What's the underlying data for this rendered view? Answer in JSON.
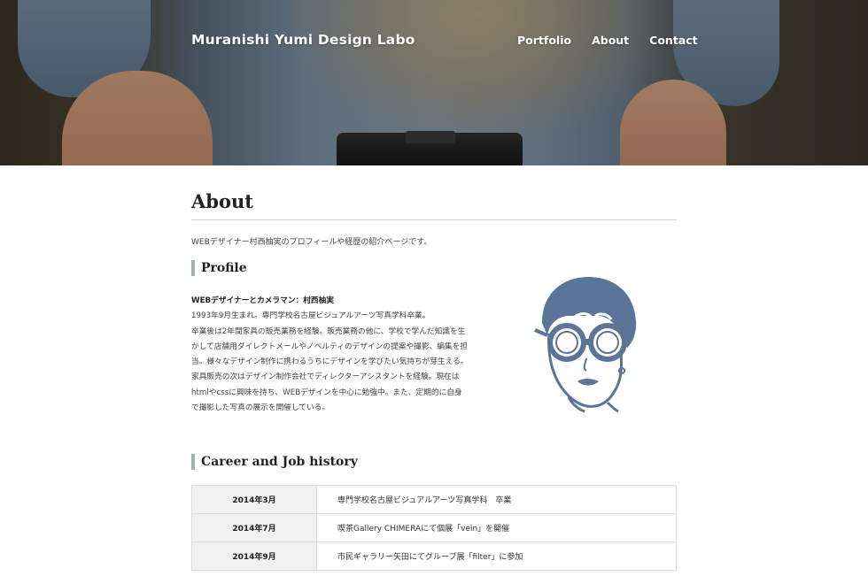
{
  "header": {
    "brand": "Muranishi Yumi Design Labo",
    "nav": [
      "Portfolio",
      "About",
      "Contact"
    ]
  },
  "page": {
    "title": "About",
    "intro": "WEBデザイナー村西柚実のプロフィールや経歴の紹介ページです。"
  },
  "profile": {
    "heading": "Profile",
    "lead": "WEBデザイナーとカメラマン：村西柚実",
    "lines": [
      "1993年9月生まれ。専門学校名古屋ビジュアルアーツ写真学科卒業。",
      "卒業後は2年間家具の販売業務を経験。販売業務の他に、学校で学んだ知識を生",
      "かして店舗用ダイレクトメールやノベルティのデザインの提案や撮影、編集を担",
      "当。様々なデザイン制作に携わるうちにデザインを学びたい気持ちが芽生える。",
      "家具販売の次はデザイン制作会社でディレクターアシスタントを経験。現在は",
      "htmlやcssに興味を持ち、WEBデザインを中心に勉強中。また、定期的に自身",
      "で撮影した写真の展示を開催している。"
    ]
  },
  "career": {
    "heading": "Career and Job history",
    "rows": [
      {
        "date": "2014年3月",
        "desc": "専門学校名古屋ビジュアルアーツ写真学科　卒業"
      },
      {
        "date": "2014年7月",
        "desc": "喫茶Gallery CHIMERAにて個展「vein」を開催"
      },
      {
        "date": "2014年9月",
        "desc": "市民ギャラリー矢田にてグループ展「filter」に参加"
      }
    ]
  },
  "colors": {
    "accent": "#9bb6a7",
    "portrait": "#5b7599"
  }
}
